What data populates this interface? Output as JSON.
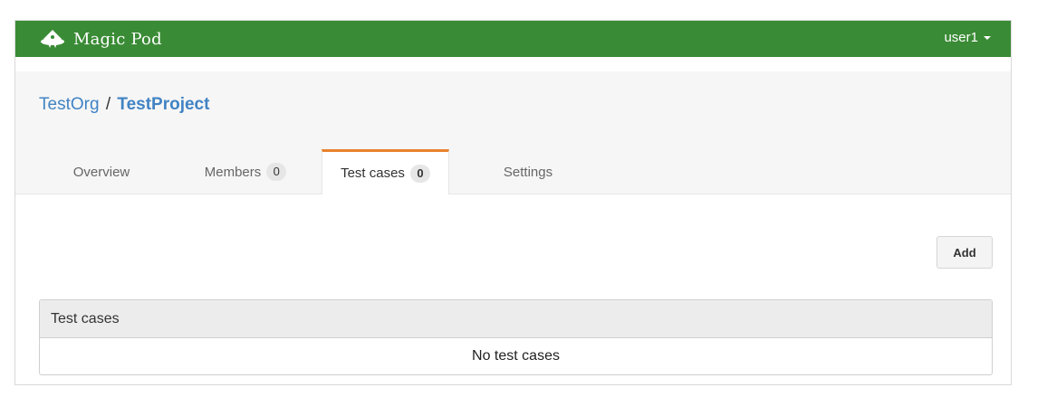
{
  "navbar": {
    "brand": "Magic Pod",
    "brand_icon": "magic-pod-logo-icon",
    "user": "user1",
    "color": "#3a8b35"
  },
  "breadcrumb": {
    "org": "TestOrg",
    "separator": "/",
    "project": "TestProject",
    "link_color": "#4183c4"
  },
  "tabs": [
    {
      "label": "Overview"
    },
    {
      "label": "Members",
      "count": "0"
    },
    {
      "label": "Test cases",
      "count": "0",
      "active": true
    },
    {
      "label": "Settings"
    }
  ],
  "active_tab_accent": "#e8812c",
  "actions": {
    "add_label": "Add"
  },
  "test_cases_panel": {
    "heading": "Test cases",
    "empty_message": "No test cases"
  }
}
